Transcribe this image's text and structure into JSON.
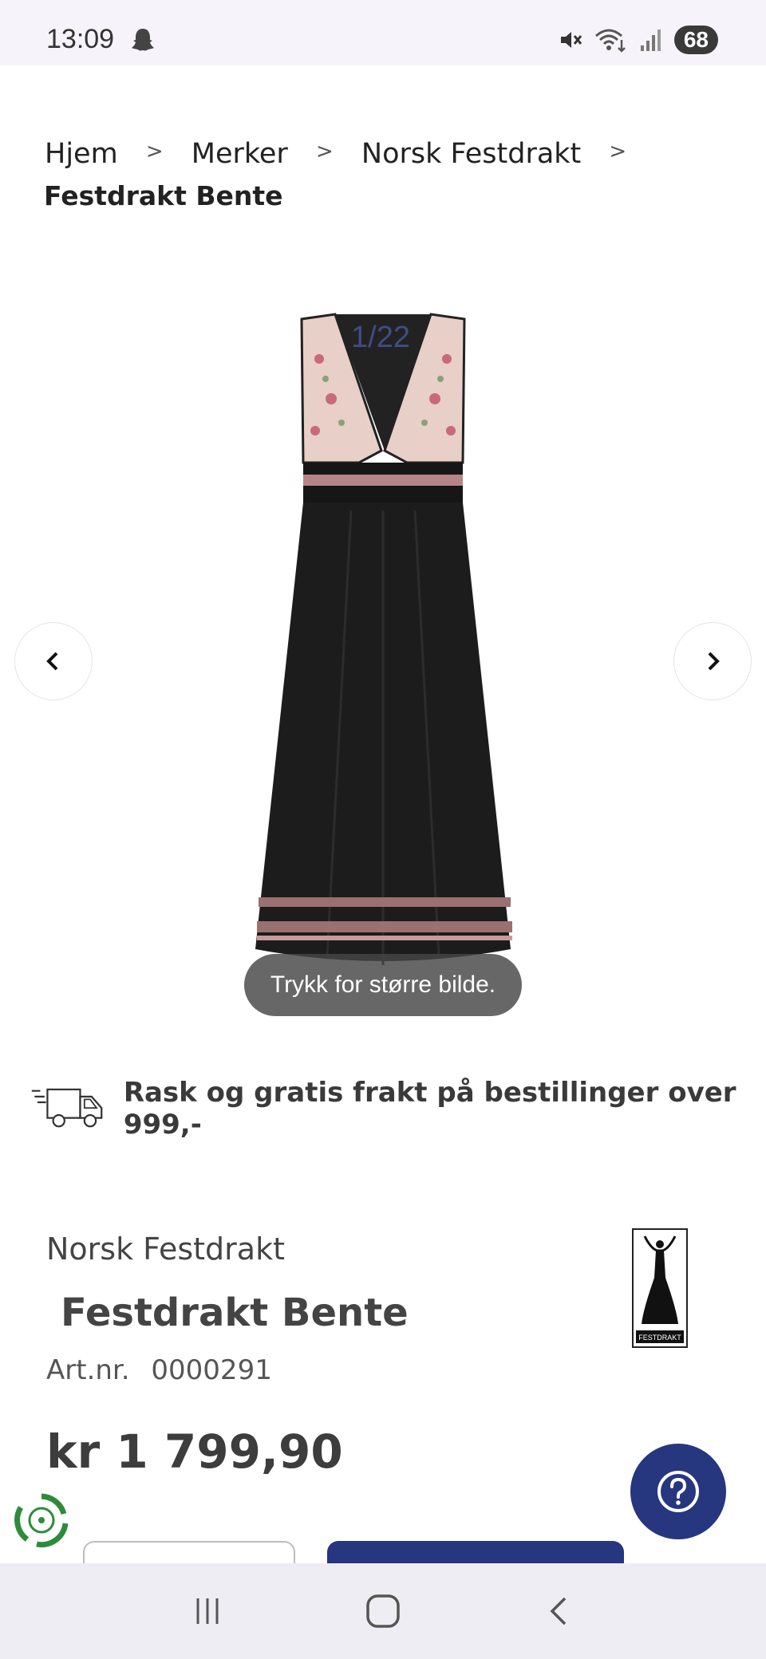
{
  "status_bar": {
    "time": "13:09",
    "battery": "68"
  },
  "breadcrumb": {
    "items": [
      "Hjem",
      "Merker",
      "Norsk Festdrakt"
    ],
    "separator": ">",
    "current": "Festdrakt Bente"
  },
  "gallery": {
    "counter": "1/22",
    "zoom_hint": "Trykk for større bilde."
  },
  "shipping": {
    "text": "Rask og gratis frakt på bestillinger over 999,-"
  },
  "product": {
    "brand": "Norsk Festdrakt",
    "title": "Festdrakt Bente",
    "art_label": "Art.nr.",
    "art_number": "0000291",
    "price": "kr 1 799,90",
    "logo_text": "FESTDRAKT"
  },
  "colors": {
    "primary": "#26367f",
    "status_bg": "#f6f4fa",
    "nav_bg": "#eeedf3"
  }
}
